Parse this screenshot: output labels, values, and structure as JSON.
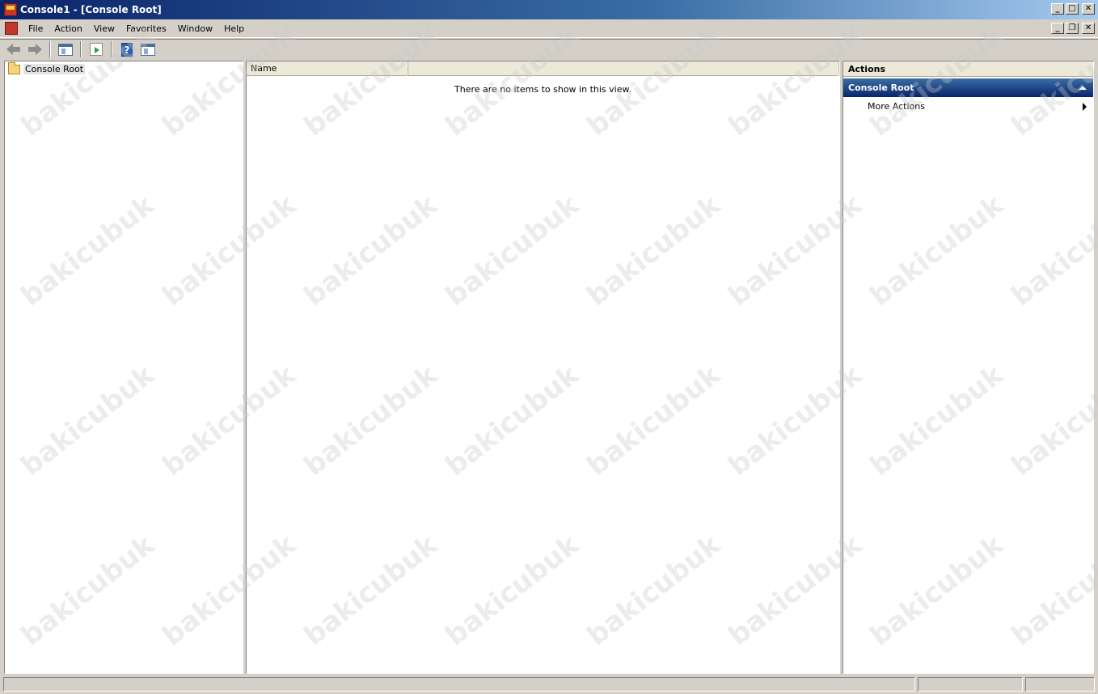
{
  "window": {
    "title": "Console1 - [Console Root]",
    "minimize": "_",
    "maximize": "□",
    "close": "✕",
    "restore": "❐"
  },
  "menu": {
    "items": [
      "File",
      "Action",
      "View",
      "Favorites",
      "Window",
      "Help"
    ]
  },
  "toolbar": {
    "icons": [
      "back-icon",
      "forward-icon",
      "show-hide-tree-icon",
      "export-list-icon",
      "help-icon",
      "show-hide-action-pane-icon"
    ],
    "help_glyph": "?"
  },
  "tree": {
    "root_label": "Console Root"
  },
  "list": {
    "columns": [
      "Name",
      ""
    ],
    "empty_message": "There are no items to show in this view."
  },
  "actions": {
    "title": "Actions",
    "section_title": "Console Root",
    "items": [
      "More Actions"
    ]
  },
  "watermark": {
    "text": "bakicubuk"
  },
  "colors": {
    "titlebar_start": "#0a246a",
    "titlebar_end": "#a6caf0",
    "actions_header": "#3a6ea5",
    "window_bg": "#d4d0c8"
  }
}
